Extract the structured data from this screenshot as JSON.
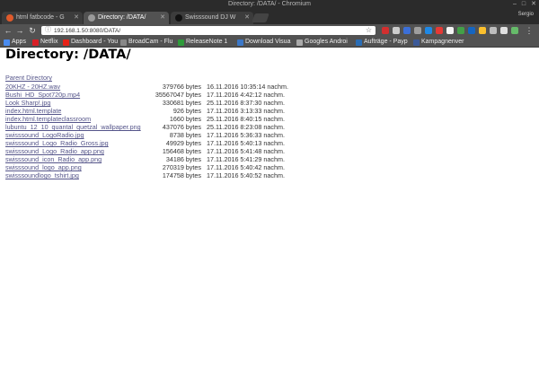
{
  "window": {
    "title": "Directory: /DATA/ - Chromium"
  },
  "tabs": [
    {
      "label": "html fatbcode - G"
    },
    {
      "label": "Directory: /DATA/"
    },
    {
      "label": "Swisssound DJ W"
    }
  ],
  "profile": "Sergio",
  "toolbar": {
    "url": "192.168.1.50:8080/DATA/"
  },
  "bookmarks": [
    {
      "label": "Apps",
      "color": "#4a8cf0"
    },
    {
      "label": "Netflix",
      "color": "#d81f26"
    },
    {
      "label": "Dashboard - You",
      "color": "#e62117"
    },
    {
      "label": "BroadCam - Flu",
      "color": "#888888"
    },
    {
      "label": "ReleaseNote 1",
      "color": "#2e9b3a"
    },
    {
      "label": "Download Visua",
      "color": "#3c78c8"
    },
    {
      "label": "Googles Androi",
      "color": "#aaaaaa"
    },
    {
      "label": "Aufträge - Payp",
      "color": "#2a6db5"
    },
    {
      "label": "Kampagnenver",
      "color": "#3b5998"
    }
  ],
  "page": {
    "heading": "Directory: /DATA/",
    "parent_link": "Parent Directory",
    "files": [
      {
        "name": "20KHZ - 20HZ.wav",
        "size": "379766 bytes",
        "date": "16.11.2016 10:35:14 nachm."
      },
      {
        "name": "Bushi_HD_Spot720p.mp4",
        "size": "35567047 bytes",
        "date": "17.11.2016 4:42:12 nachm."
      },
      {
        "name": "Look Sharp!.jpg",
        "size": "330681 bytes",
        "date": "25.11.2016 8:37:30 nachm."
      },
      {
        "name": "index.html.template",
        "size": "926 bytes",
        "date": "17.11.2016 3:13:33 nachm."
      },
      {
        "name": "index.html.templateclassroom",
        "size": "1660 bytes",
        "date": "25.11.2016 8:40:15 nachm."
      },
      {
        "name": "lubuntu_12_10_quantal_quetzal_wallpaper.png",
        "size": "437076 bytes",
        "date": "25.11.2016 8:23:08 nachm."
      },
      {
        "name": "swisssound_LogoRadio.jpg",
        "size": "8738 bytes",
        "date": "17.11.2016 5:36:33 nachm."
      },
      {
        "name": "swisssound_Logo_Radio_Gross.jpg",
        "size": "49929 bytes",
        "date": "17.11.2016 5:40:13 nachm."
      },
      {
        "name": "swisssound_Logo_Radio_app.png",
        "size": "156468 bytes",
        "date": "17.11.2016 5:41:48 nachm."
      },
      {
        "name": "swisssound_icon_Radio_app.png",
        "size": "34186 bytes",
        "date": "17.11.2016 5:41:29 nachm."
      },
      {
        "name": "swisssound_logo_app.png",
        "size": "270319 bytes",
        "date": "17.11.2016 5:40:42 nachm."
      },
      {
        "name": "swisssoundlogo_tshirt.jpg",
        "size": "174758 bytes",
        "date": "17.11.2016 5:40:52 nachm."
      }
    ]
  }
}
